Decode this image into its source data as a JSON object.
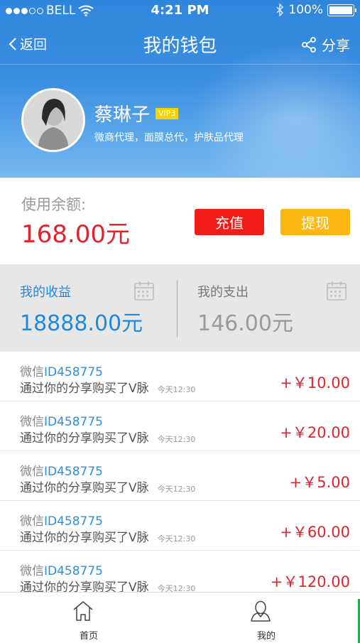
{
  "status_bar": {
    "carrier": "BELL",
    "time": "4:21 PM",
    "battery": "100%"
  },
  "nav": {
    "back_label": "返回",
    "title": "我的钱包",
    "share_label": "分享"
  },
  "profile": {
    "name": "蔡琳子",
    "badge": "VIP3",
    "description": "微商代理，面膜总代，护肤品代理"
  },
  "balance": {
    "label": "使用余额:",
    "amount": "168.00元",
    "recharge_label": "充值",
    "withdraw_label": "提现"
  },
  "stats": {
    "income": {
      "label": "我的收益",
      "value": "18888.00元"
    },
    "expense": {
      "label": "我的支出",
      "value": "146.00元"
    }
  },
  "transactions": [
    {
      "prefix": "微信",
      "id": "ID458775",
      "desc": "通过你的分享购买了V脉",
      "time": "今天12:30",
      "amount": "+￥10.00"
    },
    {
      "prefix": "微信",
      "id": "ID458775",
      "desc": "通过你的分享购买了V脉",
      "time": "今天12:30",
      "amount": "+￥20.00"
    },
    {
      "prefix": "微信",
      "id": "ID458775",
      "desc": "通过你的分享购买了V脉",
      "time": "今天12:30",
      "amount": "+￥5.00"
    },
    {
      "prefix": "微信",
      "id": "ID458775",
      "desc": "通过你的分享购买了V脉",
      "time": "今天12:30",
      "amount": "+￥60.00"
    },
    {
      "prefix": "微信",
      "id": "ID458775",
      "desc": "通过你的分享购买了V脉",
      "time": "今天12:30",
      "amount": "+￥120.00"
    }
  ],
  "tabbar": {
    "home_label": "首页",
    "mine_label": "我的"
  },
  "colors": {
    "header_blue": "#2f86dc",
    "accent_red": "#e5212b",
    "button_red": "#f21c18",
    "button_yellow": "#fdb713",
    "link_blue": "#2b8fe0"
  }
}
